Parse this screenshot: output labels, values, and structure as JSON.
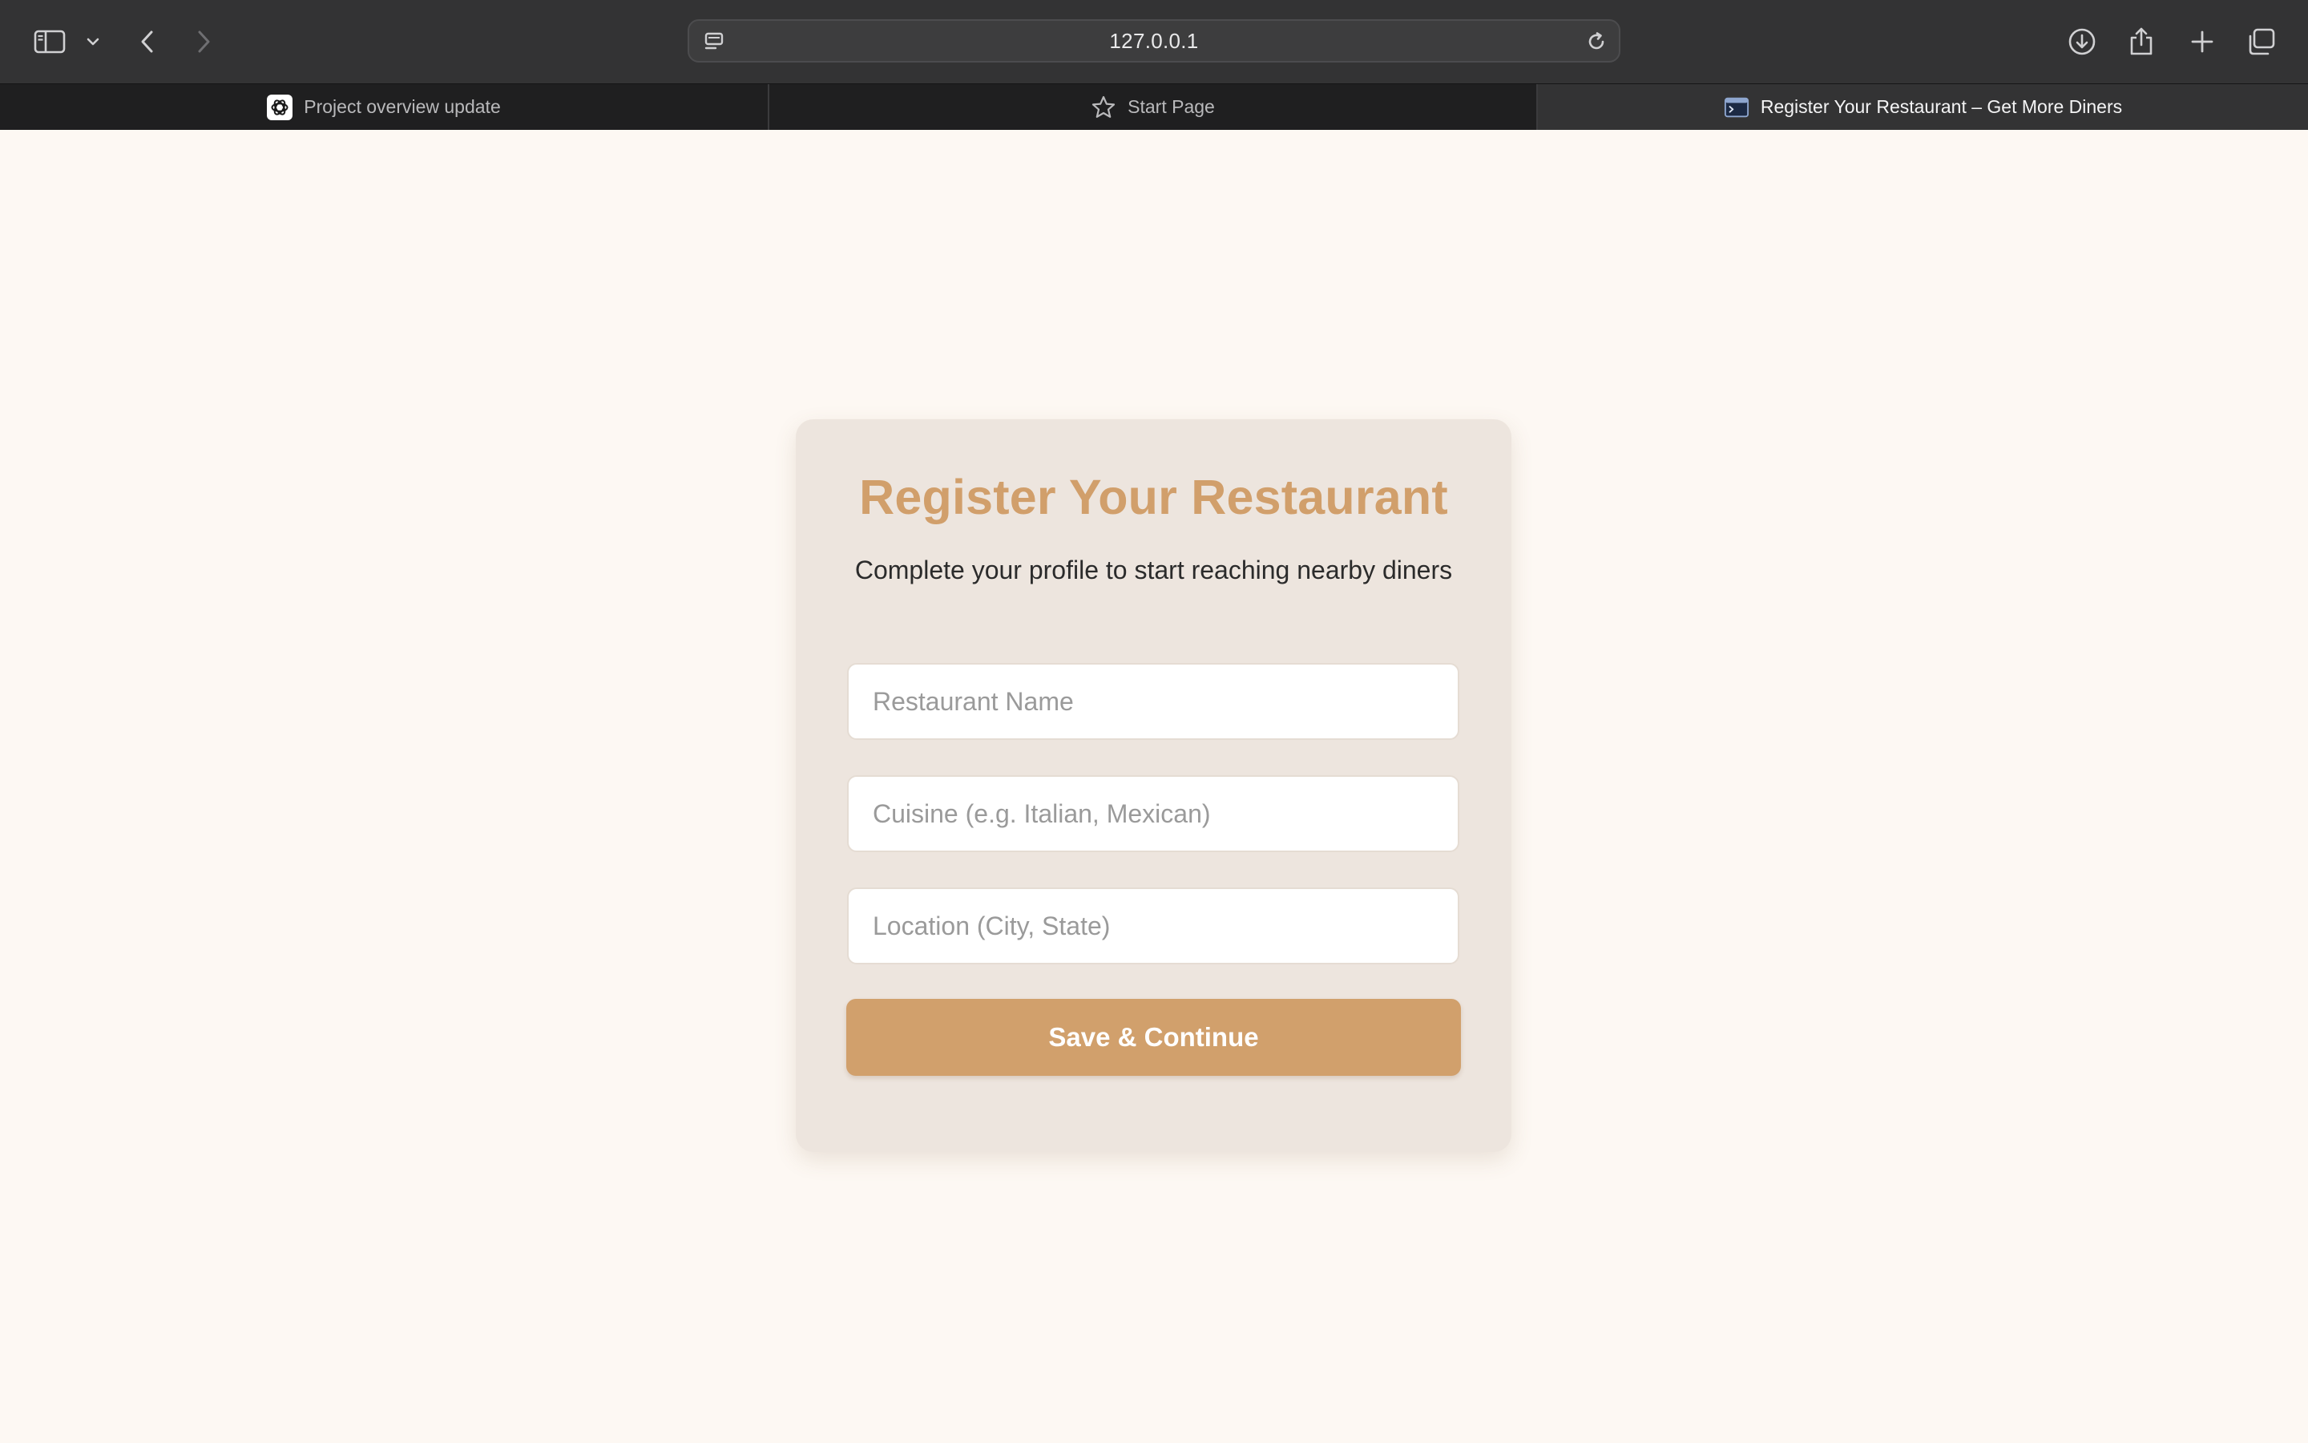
{
  "browser": {
    "url": "127.0.0.1",
    "tabs": [
      {
        "label": "Project overview update",
        "icon": "openai-logo-icon"
      },
      {
        "label": "Start Page",
        "icon": "star-icon"
      },
      {
        "label": "Register Your Restaurant – Get More Diners",
        "icon": "terminal-window-icon",
        "active": true
      }
    ]
  },
  "form": {
    "title": "Register Your Restaurant",
    "subtitle": "Complete your profile to start reaching nearby diners",
    "fields": {
      "name_placeholder": "Restaurant Name",
      "cuisine_placeholder": "Cuisine (e.g. Italian, Mexican)",
      "location_placeholder": "Location (City, State)"
    },
    "submit_label": "Save & Continue"
  },
  "colors": {
    "accent": "#d1a06c",
    "page_background": "#fdf8f3",
    "card_background": "#ede5de",
    "chrome_background": "#333334"
  }
}
